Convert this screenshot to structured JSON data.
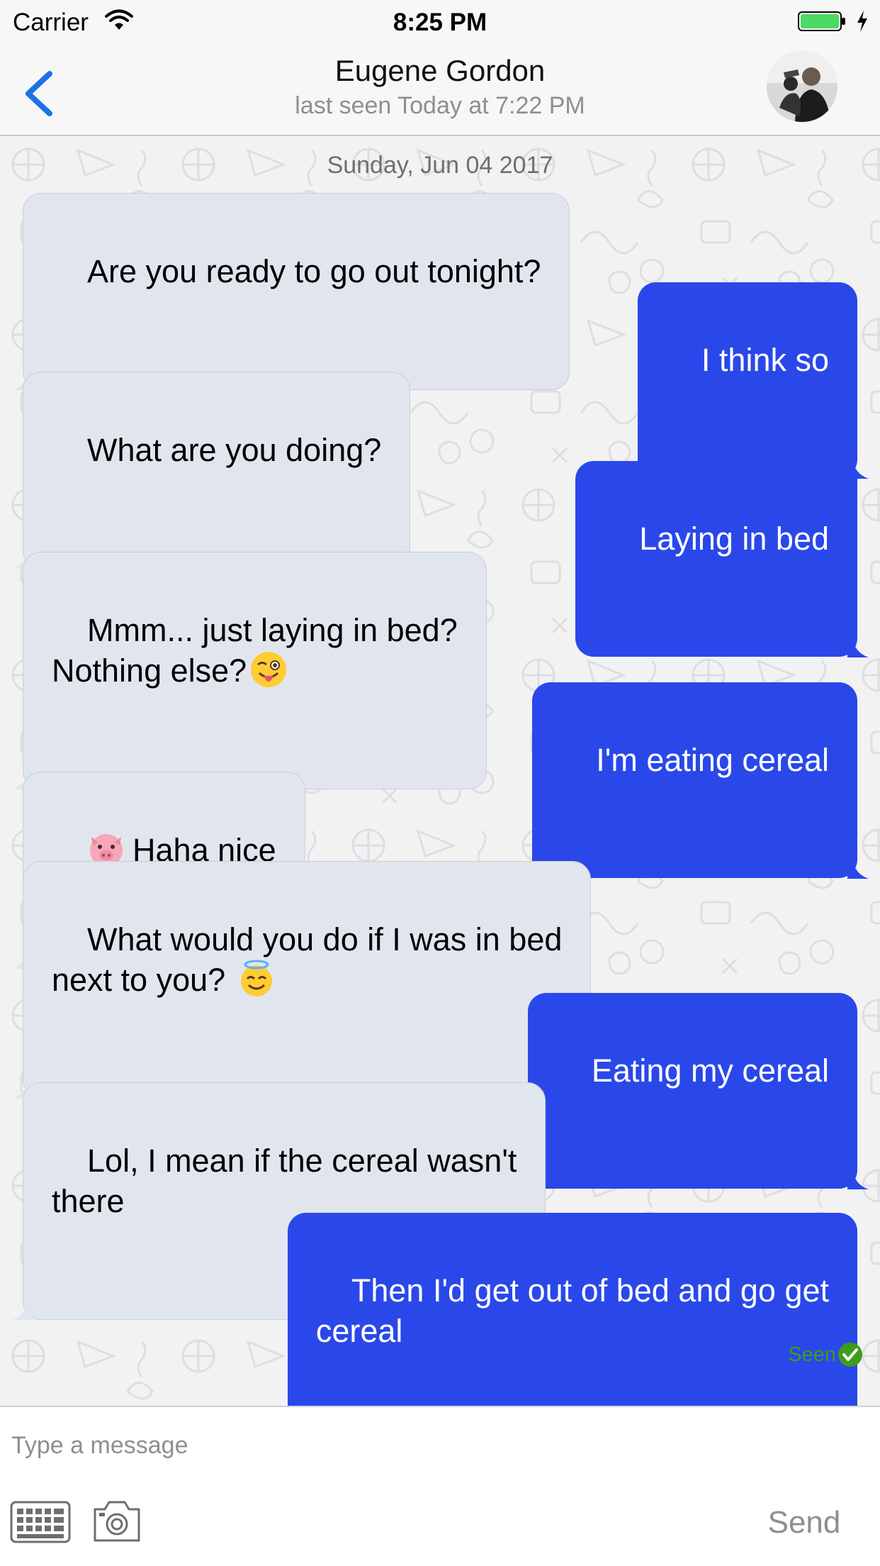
{
  "status_bar": {
    "carrier": "Carrier",
    "time": "8:25 PM",
    "battery_color": "#4cd964"
  },
  "header": {
    "contact_name": "Eugene Gordon",
    "last_seen": "last seen Today at 7:22 PM",
    "back_icon": "chevron-left-icon",
    "accent_color": "#1a73e8"
  },
  "chat": {
    "date_header": "Sunday, Jun 04 2017",
    "messages": [
      {
        "direction": "incoming",
        "text": "Are you ready to go out tonight?"
      },
      {
        "direction": "outgoing",
        "text": "I think so"
      },
      {
        "direction": "incoming",
        "text": "What are you doing?"
      },
      {
        "direction": "outgoing",
        "text": "Laying in bed"
      },
      {
        "direction": "incoming",
        "text": "Mmm... just laying in bed?\nNothing else?",
        "emoji_after": "winking-face-with-tongue-emoji"
      },
      {
        "direction": "outgoing",
        "text": "I'm eating cereal"
      },
      {
        "direction": "incoming",
        "text": "Haha nice",
        "emoji_before": "pig-face-emoji"
      },
      {
        "direction": "incoming",
        "text": "What would you do if I was in bed\nnext to you? ",
        "emoji_after": "smiling-face-with-halo-emoji"
      },
      {
        "direction": "outgoing",
        "text": "Eating my cereal"
      },
      {
        "direction": "incoming",
        "text": "Lol, I mean if the cereal wasn't\nthere"
      },
      {
        "direction": "outgoing",
        "text": "Then I'd get out of bed and go get\ncereal"
      }
    ],
    "seen_label": "Seen",
    "incoming_color": "#e1e6ee",
    "outgoing_color": "#2a48ea",
    "seen_color": "#3f9c1c"
  },
  "input_bar": {
    "placeholder": "Type a message",
    "send_label": "Send",
    "icons": [
      "keyboard-icon",
      "camera-icon"
    ]
  }
}
